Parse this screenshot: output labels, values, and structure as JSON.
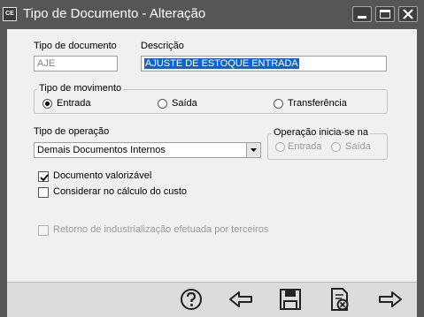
{
  "window": {
    "title": "Tipo de Documento - Alteração",
    "app_icon_text": "CE"
  },
  "form": {
    "tipo_documento_label": "Tipo de documento",
    "tipo_documento_value": "AJE",
    "descricao_label": "Descrição",
    "descricao_value": "AJUSTE DE ESTOQUE ENTRADA",
    "movimento": {
      "legend": "Tipo de movimento",
      "options": [
        "Entrada",
        "Saída",
        "Transferência"
      ],
      "selected": "Entrada"
    },
    "operacao_label": "Tipo de operação",
    "operacao_value": "Demais Documentos Internos",
    "operacao_inicia": {
      "legend": "Operação inicia-se na",
      "options": [
        "Entrada",
        "Saída"
      ]
    },
    "checkboxes": [
      {
        "label": "Documento valorizável",
        "checked": true,
        "enabled": true
      },
      {
        "label": "Considerar no cálculo do custo",
        "checked": false,
        "enabled": true
      },
      {
        "label": "Retorno de industrialização efetuada por terceiros",
        "checked": false,
        "enabled": false
      }
    ]
  },
  "toolbar": {
    "icons": [
      "help-icon",
      "back-arrow-icon",
      "save-icon",
      "delete-document-icon",
      "forward-arrow-icon"
    ]
  },
  "colors": {
    "titlebar": "#565656",
    "selection": "#0a64d6",
    "content_bg": "#f0f0f0"
  }
}
